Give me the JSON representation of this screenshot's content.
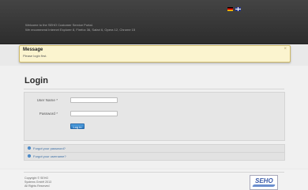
{
  "header": {
    "welcome_line1": "Welcome to the SEHO Customer Service Portal.",
    "welcome_line2": "We recommend Internet Explorer 8, Firefox 36, Safari 6, Opera 12, Chrome 15",
    "languages": [
      {
        "name": "German",
        "icon": "flag-de"
      },
      {
        "name": "English",
        "icon": "flag-en"
      }
    ]
  },
  "message": {
    "title": "Message",
    "text": "Please login first.",
    "close": "×"
  },
  "login": {
    "title": "Login",
    "username_label": "User Name",
    "password_label": "Password",
    "required_mark": "*",
    "username_value": "",
    "password_value": "",
    "submit_label": "Log in"
  },
  "links": {
    "forgot_password": "Forgot your password?",
    "forgot_username": "Forgot your username?"
  },
  "footer": {
    "line1": "Copyright © SEHO",
    "line2": "Systems GmbH 2013",
    "line3": "All Rights Reserved",
    "logo_text": "SEHO"
  },
  "colors": {
    "header_bg": "#2d2d2d",
    "message_bg": "#fbf4cf",
    "button_blue": "#2c79c2",
    "link_blue": "#3a6ea5"
  }
}
